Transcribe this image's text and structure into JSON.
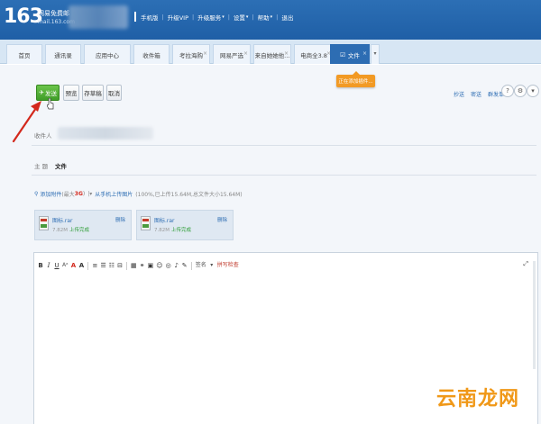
{
  "header": {
    "logo": "163",
    "logo_name": "网易免费邮",
    "logo_domain": "mail.163.com",
    "links": [
      {
        "label": "手机版",
        "arrow": false
      },
      {
        "label": "升级VIP",
        "arrow": false
      },
      {
        "label": "升级服务",
        "arrow": true
      },
      {
        "label": "设置",
        "arrow": true
      },
      {
        "label": "帮助",
        "arrow": true
      },
      {
        "label": "退出",
        "arrow": false
      }
    ]
  },
  "tabs": [
    {
      "label": "首页",
      "closable": false,
      "active": false
    },
    {
      "label": "通讯录",
      "closable": false,
      "active": false
    },
    {
      "label": "应用中心",
      "closable": false,
      "active": false
    },
    {
      "label": "收件箱",
      "closable": false,
      "active": false
    },
    {
      "label": "考拉海购",
      "closable": true,
      "active": false
    },
    {
      "label": "网易严选",
      "closable": true,
      "active": false
    },
    {
      "label": "来自她她他...",
      "closable": true,
      "active": false
    },
    {
      "label": "电商全3.8",
      "closable": true,
      "active": false
    },
    {
      "label": "文件",
      "closable": true,
      "active": true,
      "icon": "☑"
    }
  ],
  "toolbar": {
    "send_label": "发送",
    "preview_label": "预览",
    "draft_label": "存草稿",
    "cancel_label": "取消",
    "tooltip_label": "正在添加插件...",
    "right_links": [
      "抄送",
      "密送",
      "群发单显"
    ],
    "circle_icons": [
      "?",
      "⚙",
      "▾"
    ]
  },
  "form": {
    "recipient_label": "收件人",
    "subject_label": "主 题",
    "subject_value": "文件"
  },
  "attach_row": {
    "add_label": "添加附件",
    "limit_prefix": "(最大",
    "limit_value": "3G",
    "limit_suffix": ")",
    "from_phone_label": "从手机上传图片",
    "progress_text": "(100%,已上传15.64M,总文件大小15.64M)"
  },
  "attachments": [
    {
      "name": "图标.rar",
      "size": "7.82M",
      "status": "上传完成",
      "delete_label": "删除"
    },
    {
      "name": "图标.rar",
      "size": "7.82M",
      "status": "上传完成",
      "delete_label": "删除"
    }
  ],
  "editor": {
    "tools": [
      {
        "text": "B",
        "cls": "b",
        "name": "bold-icon"
      },
      {
        "text": "I",
        "cls": "i",
        "name": "italic-icon"
      },
      {
        "text": "U",
        "cls": "u",
        "name": "underline-icon"
      },
      {
        "text": "Aᵃ",
        "cls": "sm",
        "name": "font-size-icon"
      },
      {
        "text": "A",
        "cls": "red",
        "name": "font-color-icon"
      },
      {
        "text": "A",
        "cls": "b",
        "name": "highlight-icon"
      },
      {
        "text": "≡",
        "cls": "",
        "name": "align-icon"
      },
      {
        "text": "☰",
        "cls": "",
        "name": "ordered-list-icon"
      },
      {
        "text": "☷",
        "cls": "",
        "name": "unordered-list-icon"
      },
      {
        "text": "⊟",
        "cls": "",
        "name": "indent-icon"
      },
      {
        "text": "▦",
        "cls": "",
        "name": "table-icon"
      },
      {
        "text": "⚭",
        "cls": "",
        "name": "link-icon"
      },
      {
        "text": "▣",
        "cls": "",
        "name": "image-icon"
      },
      {
        "text": "☺",
        "cls": "",
        "name": "emoji-icon"
      },
      {
        "text": "◎",
        "cls": "",
        "name": "screenshot-icon"
      },
      {
        "text": "♪",
        "cls": "",
        "name": "audio-icon"
      },
      {
        "text": "✎",
        "cls": "",
        "name": "format-icon"
      }
    ],
    "letterhead_label": "签名",
    "letterhead_arrow": "▾",
    "spellcheck_label": "拼写检查",
    "expand_icon": "⤢"
  },
  "watermark": "云南龙网",
  "colors": {
    "header_blue": "#1f5fa6",
    "active_tab": "#2d6db3",
    "send_green": "#3f9d28",
    "tooltip_orange": "#f29a24",
    "arrow_red": "#d3281c"
  }
}
